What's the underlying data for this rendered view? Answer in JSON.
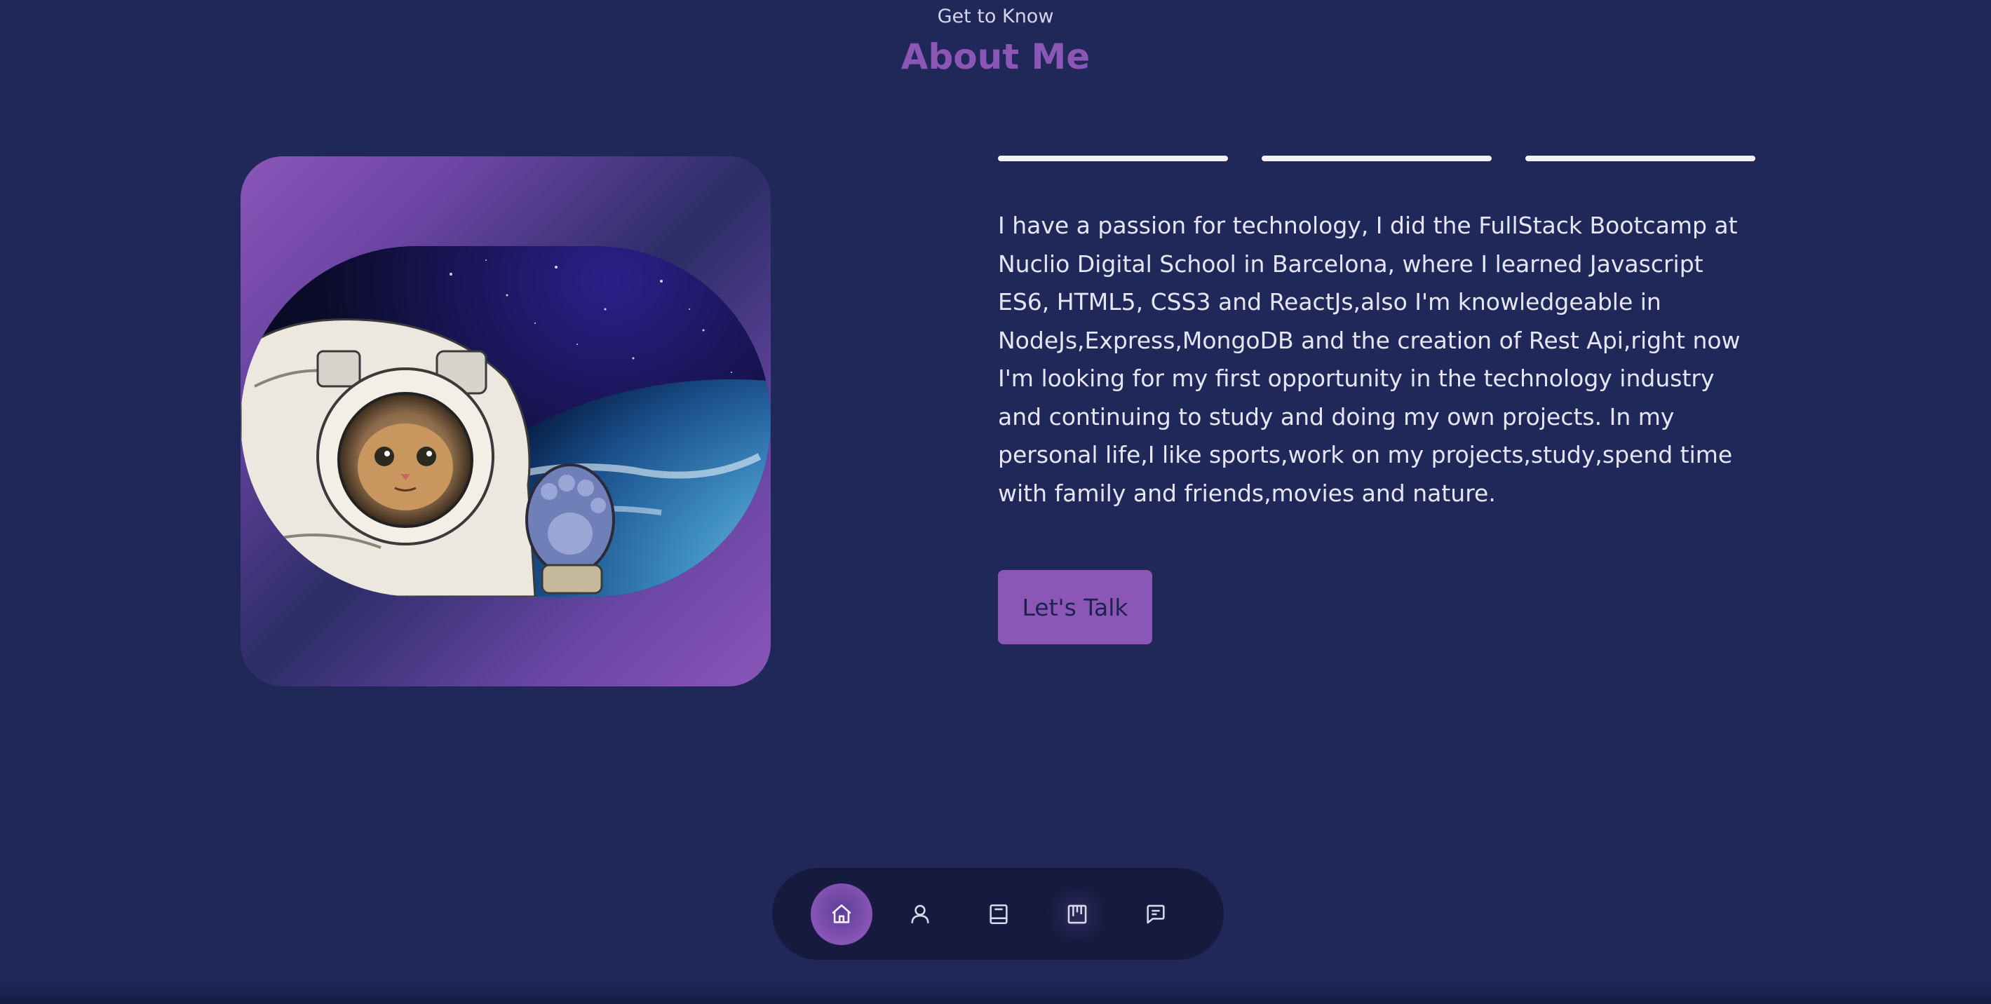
{
  "section": {
    "subtitle": "Get to Know",
    "title": "About Me"
  },
  "about": {
    "text": "I have a passion for technology, I did the FullStack Bootcamp at Nuclio Digital School in Barcelona, where I learned Javascript ES6, HTML5, CSS3 and ReactJs,also I'm knowledgeable in NodeJs,Express,MongoDB and the creation of Rest Api,right now I'm looking for my first opportunity in the technology industry and continuing to study and doing my own projects. In my personal life,I like sports,work on my projects,study,spend time with family and friends,movies and nature.",
    "cta_label": "Let's Talk"
  },
  "nav": {
    "items": [
      {
        "icon": "home-icon",
        "active": true
      },
      {
        "icon": "user-icon",
        "active": false
      },
      {
        "icon": "book-icon",
        "active": false
      },
      {
        "icon": "portfolio-icon",
        "active": false
      },
      {
        "icon": "message-icon",
        "active": false
      }
    ]
  },
  "colors": {
    "background": "#1f2859",
    "accent": "#8b56b6",
    "nav_background": "#151a3e"
  }
}
